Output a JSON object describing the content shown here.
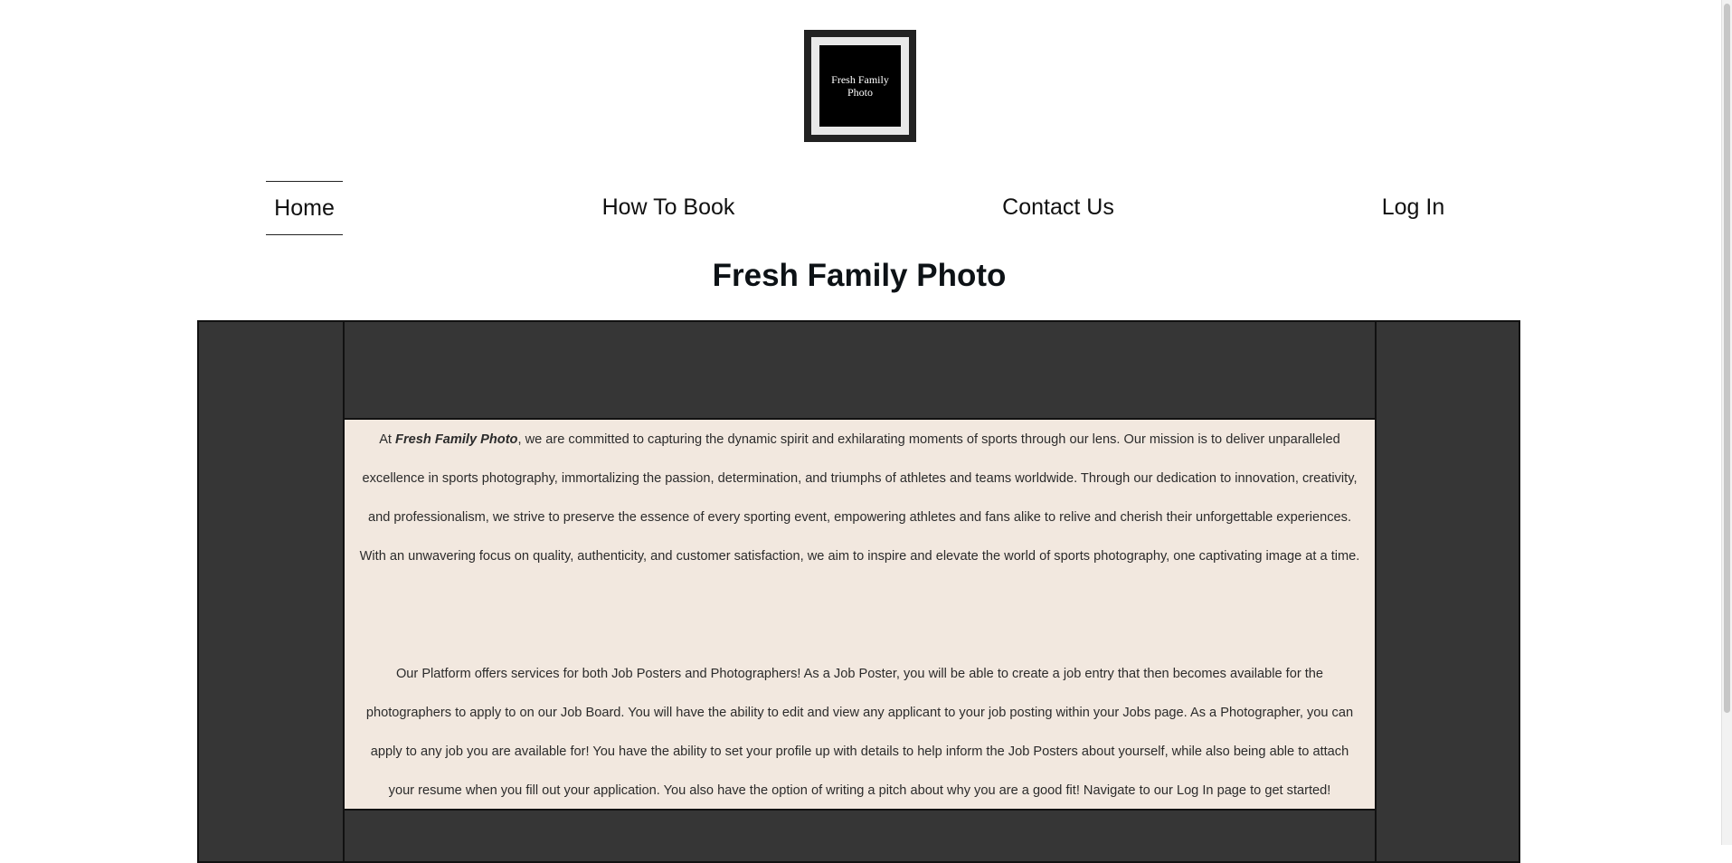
{
  "logo": {
    "text": "Fresh Family Photo"
  },
  "nav": {
    "items": [
      {
        "label": "Home",
        "active": true
      },
      {
        "label": "How To Book",
        "active": false
      },
      {
        "label": "Contact Us",
        "active": false
      },
      {
        "label": "Log In",
        "active": false
      }
    ]
  },
  "page_title": "Fresh Family Photo",
  "content": {
    "intro_prefix": "At ",
    "brand_name": "Fresh Family Photo",
    "intro_rest": ", we are committed to capturing the dynamic spirit and exhilarating moments of sports through our lens. Our mission is to deliver unparalleled excellence in sports photography, immortalizing the passion, determination, and triumphs of athletes and teams worldwide. Through our dedication to innovation, creativity, and professionalism, we strive to preserve the essence of every sporting event, empowering athletes and fans alike to relive and cherish their unforgettable experiences. With an unwavering focus on quality, authenticity, and customer satisfaction, we aim to inspire and elevate the world of sports photography, one captivating image at a time.",
    "platform_text": "Our Platform offers services for both Job Posters and Photographers! As a Job Poster, you will be able to create a job entry that then becomes available for the photographers to apply to on our Job Board. You will have the ability to edit and view any applicant to your job posting within your Jobs page. As a Photographer, you can apply to any job you are available for! You have the ability to set your profile up with details to help inform the Job Posters about yourself, while also being able to attach your resume when you fill out your application. You also have the option of writing a pitch about why you are a good fit! Navigate to our Log In page to get started!"
  },
  "colors": {
    "panel_dark": "#363636",
    "content_bg": "#f2e8df",
    "title_text": "#0d1216"
  }
}
